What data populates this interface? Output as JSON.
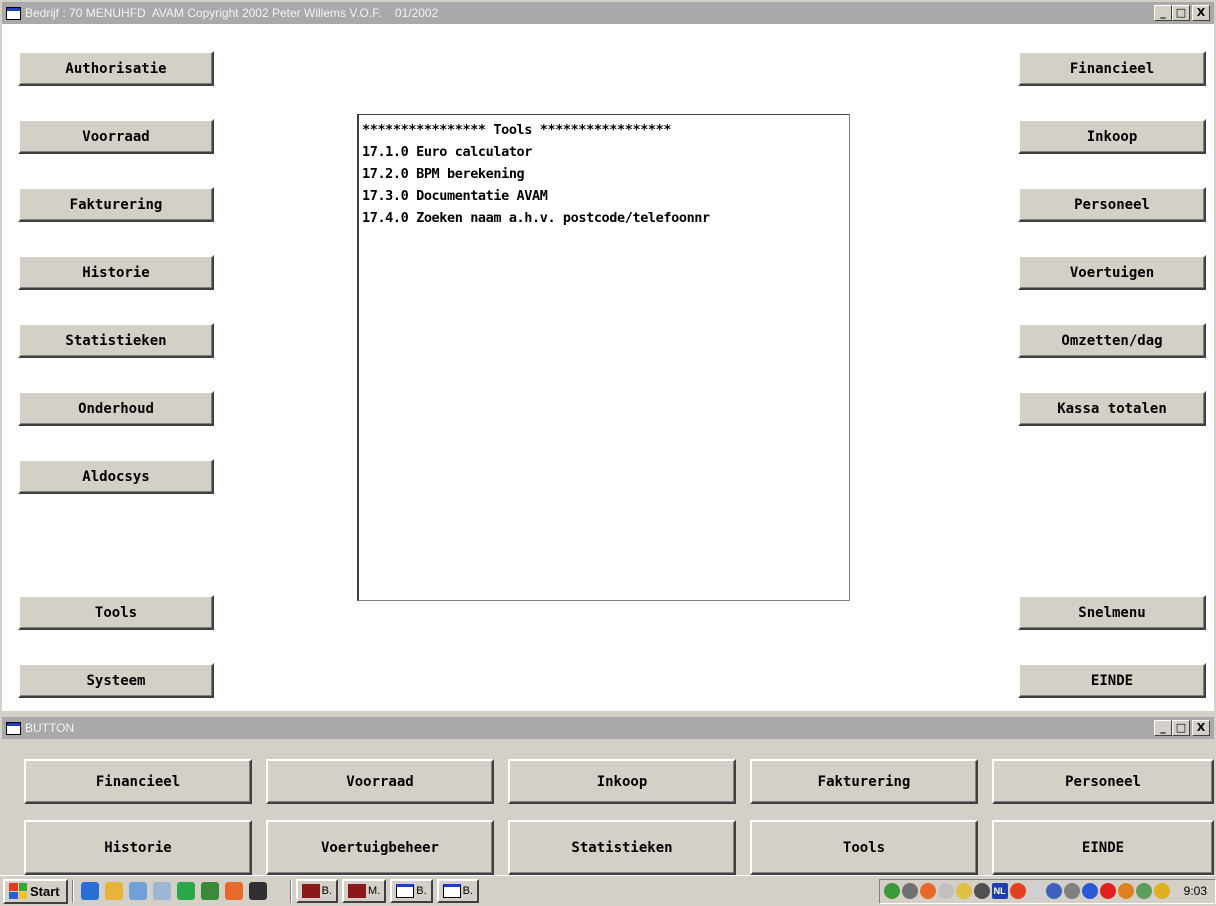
{
  "main_window": {
    "title": "Bedrijf : 70 MENUHFD  AVAM Copyright 2002 Peter Willems V.O.F.    01/2002",
    "controls": {
      "minimize": "_",
      "maximize": "□",
      "close": "X"
    },
    "left_buttons": [
      "Authorisatie",
      "Voorraad",
      "Fakturering",
      "Historie",
      "Statistieken",
      "Onderhoud",
      "Aldocsys",
      "Tools",
      "Systeem"
    ],
    "right_buttons": [
      "Financieel",
      "Inkoop",
      "Personeel",
      "Voertuigen",
      "Omzetten/dag",
      "Kassa totalen",
      "Snelmenu",
      "EINDE"
    ],
    "list": [
      "**************** Tools *****************",
      "17.1.0 Euro calculator",
      "17.2.0 BPM berekening",
      "17.3.0 Documentatie AVAM",
      "17.4.0 Zoeken naam a.h.v. postcode/telefoonnr"
    ]
  },
  "button_window": {
    "title": "BUTTON",
    "controls": {
      "minimize": "_",
      "maximize": "□",
      "close": "X"
    },
    "row1": [
      "Financieel",
      "Voorraad",
      "Inkoop",
      "Fakturering",
      "Personeel"
    ],
    "row2": [
      "Historie",
      "Voertuigbeheer",
      "Statistieken",
      "Tools",
      "EINDE"
    ]
  },
  "taskbar": {
    "start_label": "Start",
    "tasks": [
      "B.",
      "M.",
      "B.",
      "B."
    ],
    "clock": "9:03",
    "quicklaunch_icons": [
      "ie-icon",
      "edit-icon",
      "folder-icon",
      "search-icon",
      "app-green-icon",
      "excel-icon",
      "phone-icon",
      "dos-icon"
    ],
    "tray_icons": [
      "network-icon",
      "volume-icon",
      "phone-icon",
      "cd-icon",
      "globe-icon",
      "printer-icon",
      "language-icon",
      "flash-icon",
      "mouse-icon",
      "monitor-icon",
      "tool-icon",
      "shield-icon",
      "vpn-icon",
      "chart-icon",
      "agent-icon",
      "sun-icon"
    ],
    "language_label": "NL"
  }
}
